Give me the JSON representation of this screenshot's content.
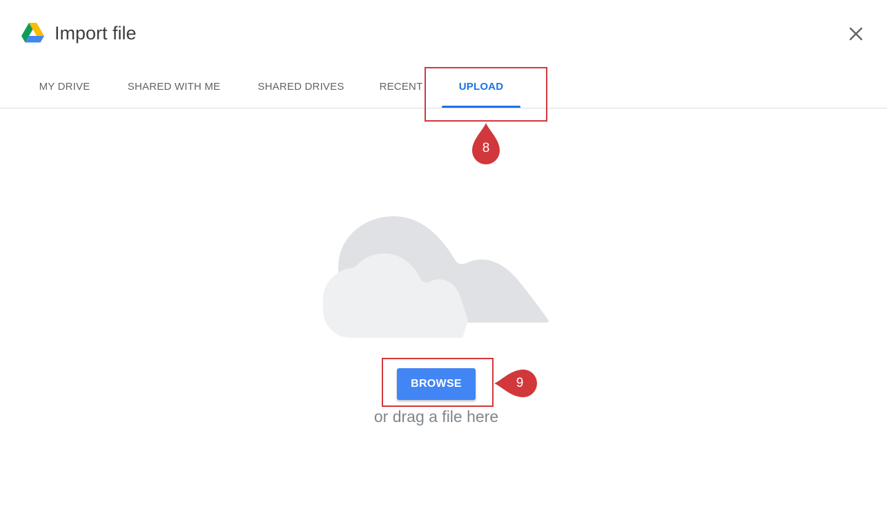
{
  "dialog": {
    "title": "Import file",
    "logo_icon": "google-drive-icon",
    "close_icon": "close-icon"
  },
  "tabs": [
    {
      "label": "MY DRIVE",
      "active": false
    },
    {
      "label": "SHARED WITH ME",
      "active": false
    },
    {
      "label": "SHARED DRIVES",
      "active": false
    },
    {
      "label": "RECENT",
      "active": false
    },
    {
      "label": "UPLOAD",
      "active": true
    }
  ],
  "upload": {
    "illustration_icon": "cloud-icon",
    "browse_label": "BROWSE",
    "drag_text": "or drag a file here"
  },
  "annotations": [
    {
      "number": "8"
    },
    {
      "number": "9"
    }
  ],
  "colors": {
    "accent": "#1a73e8",
    "button": "#4285f4",
    "annotation": "#d0383b"
  }
}
